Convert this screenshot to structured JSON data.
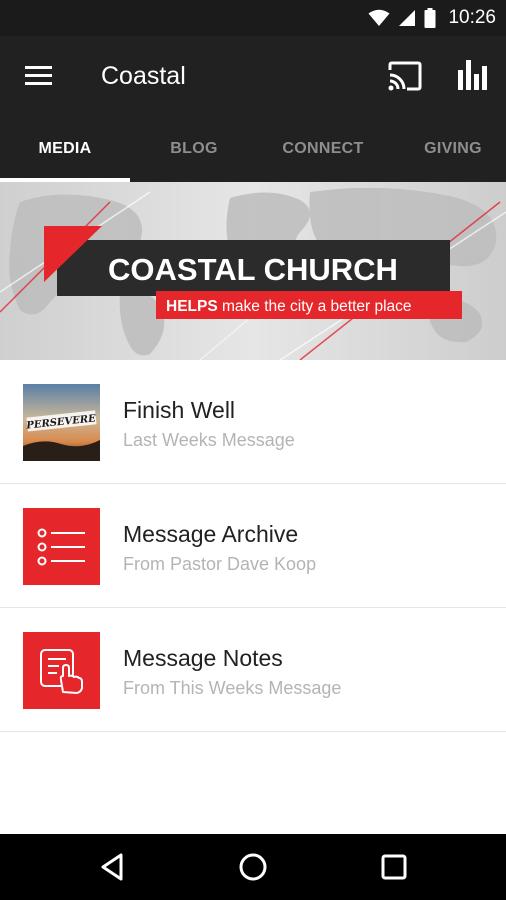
{
  "status_bar": {
    "time": "10:26",
    "icons": [
      "wifi-icon",
      "signal-icon",
      "battery-icon"
    ]
  },
  "app_bar": {
    "title": "Coastal",
    "icons": [
      "menu-icon",
      "cast-icon",
      "bar-chart-icon"
    ]
  },
  "tabs": [
    {
      "label": "MEDIA",
      "active": true
    },
    {
      "label": "BLOG",
      "active": false
    },
    {
      "label": "CONNECT",
      "active": false
    },
    {
      "label": "GIVING",
      "active": false
    }
  ],
  "banner": {
    "headline": "COASTAL CHURCH",
    "tagline_bold": "HELPS",
    "tagline_rest": "make the city a better place"
  },
  "list": [
    {
      "title": "Finish Well",
      "subtitle": "Last Weeks Message",
      "thumb_text": "PERSEVERE",
      "icon": "sermon-artwork"
    },
    {
      "title": "Message Archive",
      "subtitle": "From Pastor Dave Koop",
      "icon": "list-icon"
    },
    {
      "title": "Message Notes",
      "subtitle": "From This Weeks Message",
      "icon": "touch-notes-icon"
    }
  ],
  "nav_bar": {
    "icons": [
      "back-icon",
      "home-icon",
      "recents-icon"
    ]
  },
  "colors": {
    "accent_red": "#e5262b",
    "app_bar": "#212121",
    "status_bar": "#1b1b1c"
  }
}
